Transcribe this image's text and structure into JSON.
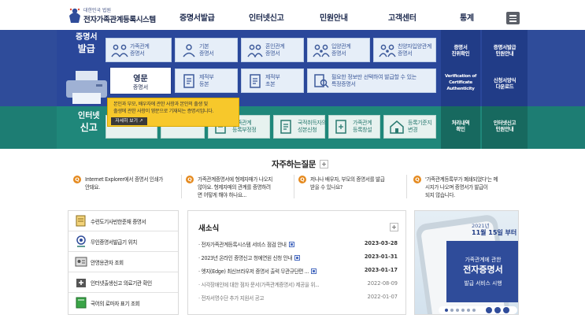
{
  "header": {
    "logo_small": "대한민국 법원",
    "logo_title": "전자가족관계등록시스템",
    "nav": [
      "증명서발급",
      "인터넷신고",
      "민원안내",
      "고객센터",
      "통계"
    ]
  },
  "cert": {
    "title_line1": "증명서",
    "title_line2": "발급",
    "row1": [
      {
        "l1": "가족관계",
        "l2": "증명서"
      },
      {
        "l1": "기본",
        "l2": "증명서"
      },
      {
        "l1": "혼인관계",
        "l2": "증명서"
      },
      {
        "l1": "입양관계",
        "l2": "증명서"
      },
      {
        "l1": "친양자입양관계",
        "l2": "증명서"
      }
    ],
    "highlight": {
      "l1": "영문",
      "l2": "증명서"
    },
    "row2": [
      {
        "l1": "제적부",
        "l2": "등본"
      },
      {
        "l1": "제적부",
        "l2": "초본"
      },
      {
        "l1": "필요한 정보만 선택하여 발급할 수 있는",
        "l2": "특정증명서"
      }
    ],
    "side": [
      {
        "l1": "증명서",
        "l2": "진위확인"
      },
      {
        "l1": "증명서발급",
        "l2": "민원안내"
      },
      {
        "l1": "Verification of",
        "l2": "Certificate",
        "l3": "Authenticity"
      },
      {
        "l1": "신청서양식",
        "l2": "다운로드"
      }
    ]
  },
  "tooltip": {
    "line1": "본인과 부모, 배우자에 관한 사항과 본인의 출생 및",
    "line2": "출생에 관한 사항이 영문으로 기재되는 증명서입니다.",
    "button": "자세히 보기"
  },
  "net": {
    "title_line1": "인터넷",
    "title_line2": "신고",
    "buttons": [
      {
        "l1": "가족관계",
        "l2": "등록부정정"
      },
      {
        "l1": "국적취득자의",
        "l2": "성본신청"
      },
      {
        "l1": "가족관계",
        "l2": "등록창설"
      },
      {
        "l1": "등록기준지",
        "l2": "변경"
      }
    ],
    "side": [
      {
        "l1": "처리내역",
        "l2": "확인"
      },
      {
        "l1": "인터넷신고",
        "l2": "민원안내"
      }
    ]
  },
  "faq": {
    "title": "자주하는질문",
    "items": [
      {
        "l1": "Internet Explorer에서 증명서 인쇄가",
        "l2": "안돼요."
      },
      {
        "l1": "가족관계증명서에 형제자매가 나오지",
        "l2": "않아요. 형제자매의 관계를 증명하려",
        "l3": "면 어떻게 해야 하나요..."
      },
      {
        "l1": "저나나 배우자, 부모의 증명서를 발급",
        "l2": "받을 수 있나요?"
      },
      {
        "l1": "'가족관계등록부가 폐쇄되었다'는 메",
        "l2": "시지가 나오며 증명서가 발급이",
        "l3": "되지 않습니다."
      }
    ]
  },
  "quick": [
    "수련도기사반한준재 증명서",
    "무인증명서발급기 위치",
    "안명용관자 조회",
    "인터넷출생신고 의료기관 확인",
    "국어의 로마자 표기 조회"
  ],
  "news": {
    "title": "새소식",
    "items": [
      {
        "text": "전자가족관계등록시스템 서비스 점검 안내",
        "date": "2023-03-28",
        "bold": true,
        "new": true
      },
      {
        "text": "2023년 온라인 증명신고 청에연원 신청 안내",
        "date": "2023-01-31",
        "bold": true,
        "new": true
      },
      {
        "text": "엣지(Edge) 최신브라우저 증명서 출력 무관규단편 ...",
        "date": "2023-01-17",
        "bold": true,
        "new": true
      },
      {
        "text": "시각장애인에 대한 점자 문서(가족관계증명서) 제공을 위...",
        "date": "2022-08-09",
        "bold": false,
        "new": false
      },
      {
        "text": "전자서명수단 추가 지원서 공고",
        "date": "2022-01-07",
        "bold": false,
        "new": false
      }
    ]
  },
  "banner": {
    "year": "2021년",
    "date": "11월 15일 부터",
    "sub": "가족관계에 관한",
    "main": "전자증명서",
    "desc": "발급 서비스 시행"
  }
}
